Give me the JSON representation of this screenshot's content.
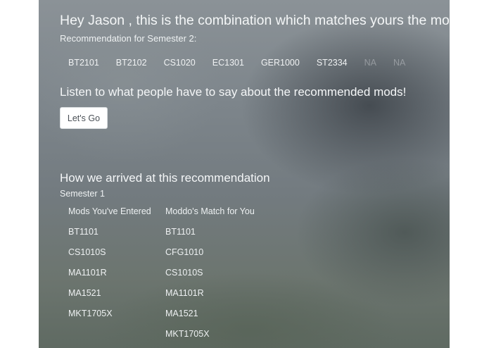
{
  "header": {
    "greeting": "Hey Jason , this is the combination which matches yours the most!",
    "subtitle": "Recommendation for Semester 2:"
  },
  "recommended_mods": [
    {
      "label": "BT2101",
      "faded": false
    },
    {
      "label": "BT2102",
      "faded": false
    },
    {
      "label": "CS1020",
      "faded": false
    },
    {
      "label": "EC1301",
      "faded": false
    },
    {
      "label": "GER1000",
      "faded": false
    },
    {
      "label": "ST2334",
      "faded": false
    },
    {
      "label": "NA",
      "faded": true
    },
    {
      "label": "NA",
      "faded": true
    }
  ],
  "reviews": {
    "prompt": "Listen to what people have to say about the recommended mods!",
    "button_label": "Let's Go"
  },
  "explanation": {
    "title": "How we arrived at this recommendation",
    "semester_label": "Semester 1",
    "entered": {
      "header": "Mods You've Entered",
      "items": [
        "BT1101",
        "CS1010S",
        "MA1101R",
        "MA1521",
        "MKT1705X"
      ]
    },
    "match": {
      "header": "Moddo's Match for You",
      "items": [
        "BT1101",
        "CFG1010",
        "CS1010S",
        "MA1101R",
        "MA1521",
        "MKT1705X"
      ]
    }
  },
  "colors": {
    "text": "#f2f4f5",
    "button_bg": "#ffffff",
    "button_text": "#4a5056"
  }
}
